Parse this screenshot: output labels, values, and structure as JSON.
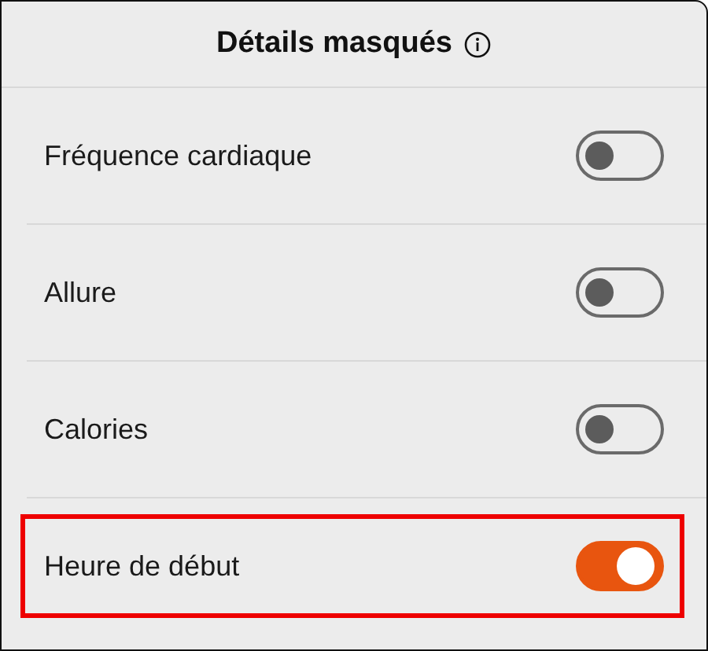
{
  "header": {
    "title": "Détails masqués"
  },
  "settings": [
    {
      "label": "Fréquence cardiaque",
      "on": false,
      "highlighted": false
    },
    {
      "label": "Allure",
      "on": false,
      "highlighted": false
    },
    {
      "label": "Calories",
      "on": false,
      "highlighted": false
    },
    {
      "label": "Heure de début",
      "on": true,
      "highlighted": true
    }
  ]
}
